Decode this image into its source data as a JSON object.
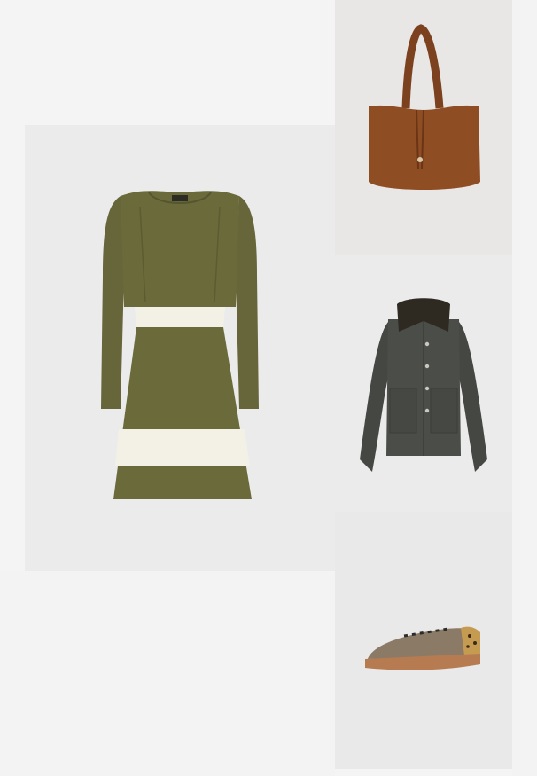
{
  "page": {
    "background": "#f4f4f4"
  },
  "items": [
    {
      "kind": "dress",
      "icon": "dress-icon",
      "colors": {
        "body": "#6b6a3a",
        "stripe": "#f3f1e6",
        "tile": "#ebebeb"
      }
    },
    {
      "kind": "tote-bag",
      "icon": "bag-icon",
      "colors": {
        "body": "#8f4d24",
        "tile": "#e8e7e5"
      }
    },
    {
      "kind": "jacket",
      "icon": "jacket-icon",
      "colors": {
        "body": "#4b4e48",
        "collar": "#2e2a22",
        "tile": "#ebebeb"
      }
    },
    {
      "kind": "sneaker",
      "icon": "sneaker-icon",
      "colors": {
        "upper": "#8b7a66",
        "sole": "#b77b52",
        "tile": "#e9e9e9"
      }
    }
  ]
}
